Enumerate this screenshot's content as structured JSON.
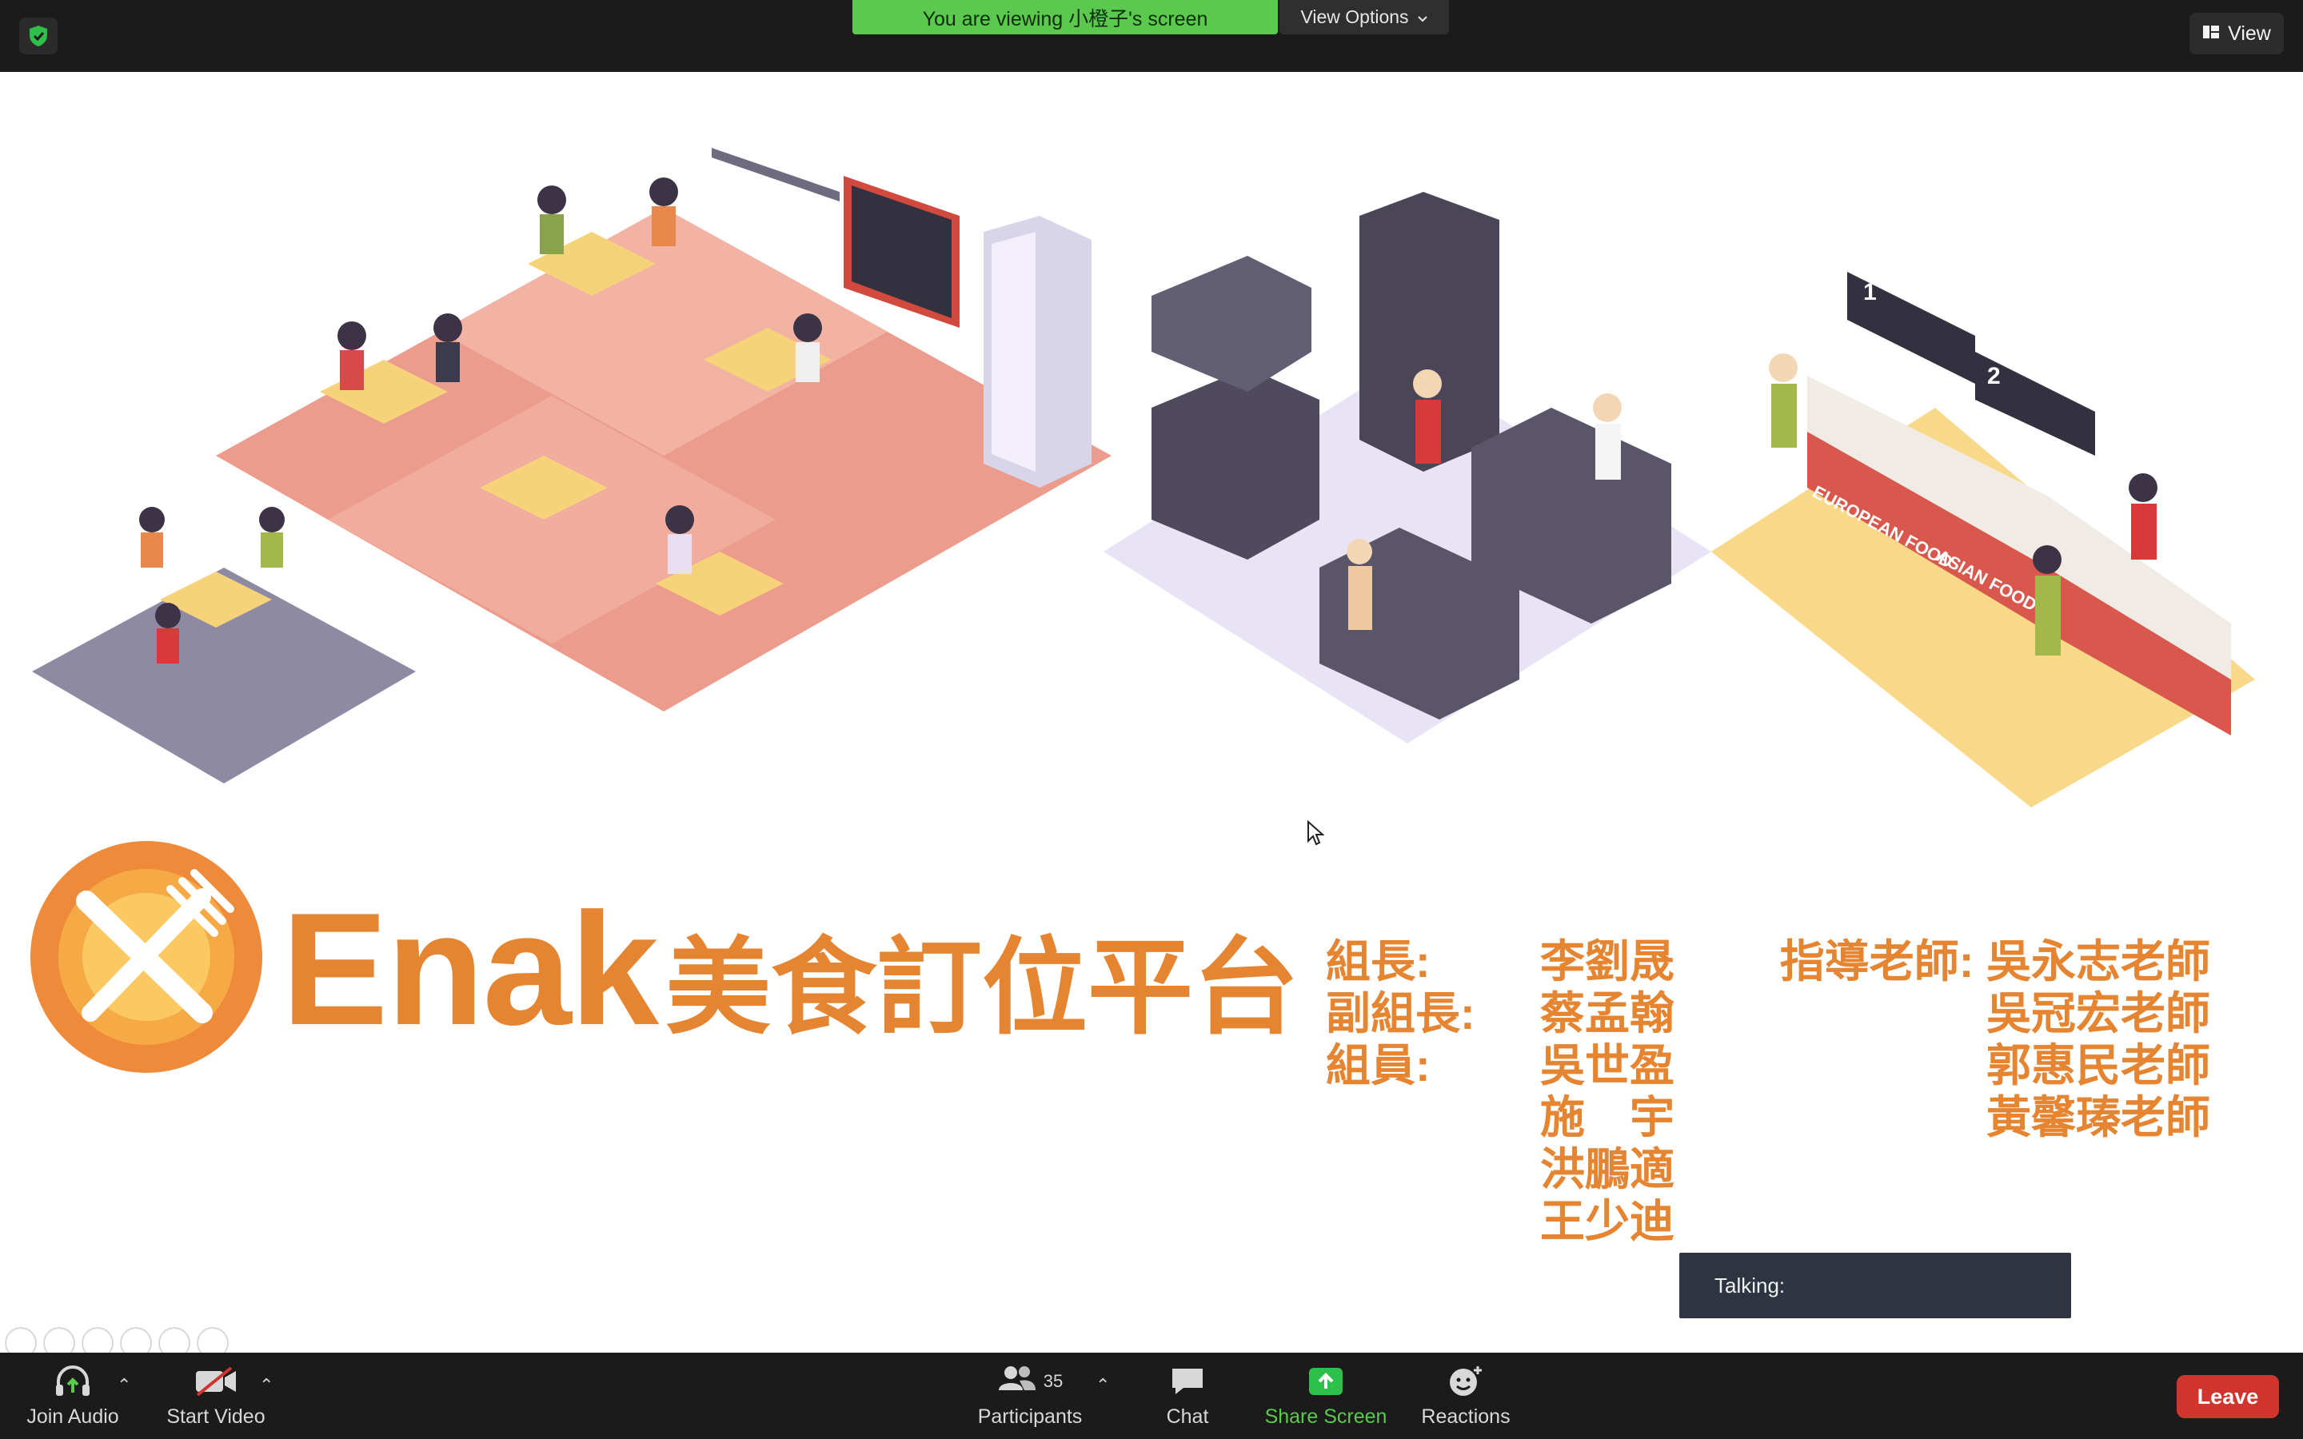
{
  "banner": {
    "viewing_text": "You are viewing 小橙子's screen",
    "view_options_label": "View Options"
  },
  "top_right": {
    "view_label": "View"
  },
  "slide": {
    "brand_en": "Enak",
    "brand_zh": "美食訂位平台",
    "illustration_labels": {
      "european": "EUROPEAN FOOD",
      "asian": "ASIAN FOOD",
      "menu_1": "1",
      "menu_2": "2"
    },
    "team": [
      {
        "role": "組長:",
        "name": "李劉晟"
      },
      {
        "role": "副組長:",
        "name": "蔡孟翰"
      },
      {
        "role": "組員:",
        "name": "吳世盈"
      },
      {
        "role": "",
        "name": "施　宇"
      },
      {
        "role": "",
        "name": "洪鵬適"
      },
      {
        "role": "",
        "name": "王少迪"
      }
    ],
    "advisors": [
      "指導老師: 吳永志老師",
      "吳冠宏老師",
      "郭惠民老師",
      "黃馨瑧老師"
    ]
  },
  "talking": {
    "label": "Talking:"
  },
  "toolbar": {
    "join_audio": "Join Audio",
    "start_video": "Start Video",
    "participants": "Participants",
    "participants_count": "35",
    "chat": "Chat",
    "share_screen": "Share Screen",
    "reactions": "Reactions",
    "leave": "Leave"
  },
  "colors": {
    "accent_orange": "#e58532",
    "share_green": "#5bc84e",
    "leave_red": "#d0342c",
    "bar_dark": "#1b1b1b"
  },
  "icons": [
    "shield-check-icon",
    "chevron-down-icon",
    "grid-view-icon",
    "headphones-icon",
    "video-off-icon",
    "participants-icon",
    "chat-icon",
    "share-screen-icon",
    "reactions-icon",
    "cursor-icon"
  ]
}
